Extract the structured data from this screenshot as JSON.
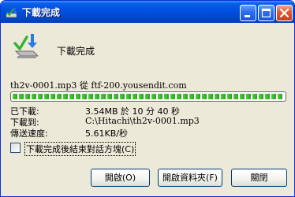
{
  "window": {
    "title": "下載完成",
    "min_glyph": "minimize",
    "max_glyph": "maximize",
    "close_glyph": "close"
  },
  "heading": "下載完成",
  "source_line": "th2v-0001.mp3 從 ftf-200.yousendit.com",
  "progress": {
    "percent": 100
  },
  "details": {
    "downloaded_label": "已下載:",
    "downloaded_value": "3.54MB 於 10 分 40 秒",
    "download_to_label": "下載到:",
    "download_to_value": "C:\\Hitachi\\th2v-0001.mp3",
    "rate_label": "傳送速度:",
    "rate_value": "5.61KB/秒"
  },
  "options": {
    "close_dialog_label": "下載完成後結束對話方塊(C)",
    "close_dialog_checked": false
  },
  "buttons": {
    "open": "開啟(O)",
    "open_folder": "開啟資料夾(F)",
    "close": "關閉"
  },
  "icons": {
    "title": "download-complete-icon",
    "main": "download-checkmark-icon"
  },
  "colors": {
    "titlebar": "#0054e3",
    "dialog_bg": "#ece9d8",
    "progress_green": "#2aa41a",
    "close_button": "#e2582f"
  }
}
